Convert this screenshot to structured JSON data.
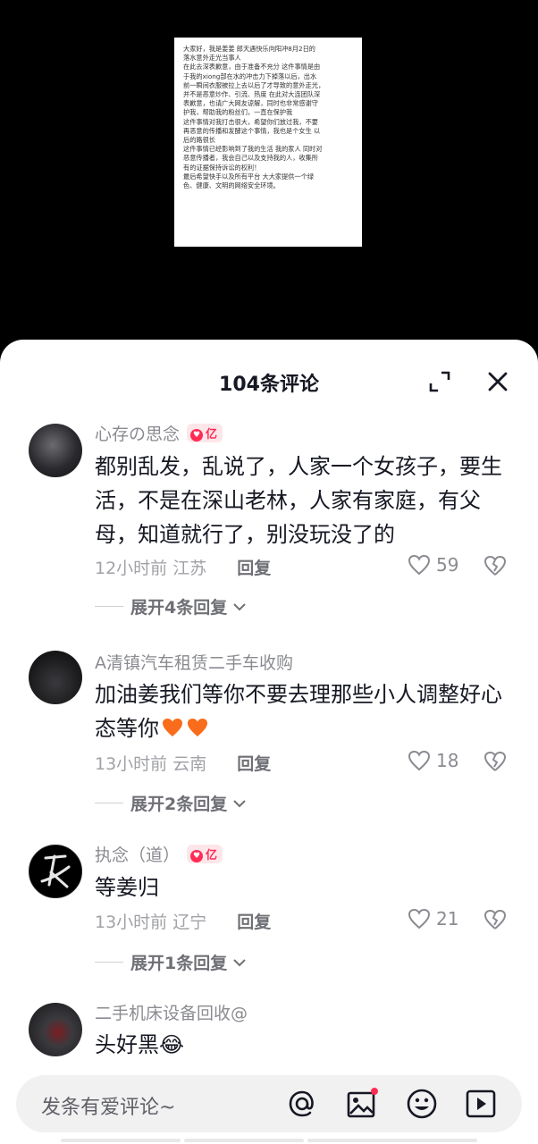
{
  "video": {
    "document_lines": [
      "大家好，我是姜姜 郎天遇快乐向阳冲8月2日的",
      "落水意外走光当事人",
      "在此去深表歉意，由于准备不充分 这件事情是由",
      "于我的xiong部在水的冲击力下掉落以后，出水",
      "前一瞬间衣服被拉上去以后了才导致的意外走光，",
      "并不是恶意炒作、引流、热度 在此对大连团队深",
      "表歉意，也请广大网友谅解，同时也非常感谢守",
      "护我，帮助我的粉丝们，一直在保护我",
      "这件事情对我打击很大，希望你们放过我，不要",
      "再恶意的传播和发酵这个事情，我也是个女生 以",
      "后的路很长",
      "这件事情已经影响到了我的生活 我的家人 同时对",
      "恶意传播者，我会自己以及支持我的人，收集所",
      "有的证据保持诉讼的权利！",
      "最后希望快手以及所有平台 大大家提供一个绿",
      "色、健康、文明的网络安全环境。"
    ]
  },
  "sheet": {
    "title": "104条评论"
  },
  "comments": [
    {
      "username": "心存の思念",
      "badge": "亿",
      "text": "都别乱发，乱说了，人家一个女孩子，要生活，不是在深山老林，人家有家庭，有父母，知道就行了，别没玩没了的",
      "time": "12小时前",
      "location": "江苏",
      "reply_label": "回复",
      "likes": "59",
      "expand_label": "展开4条回复"
    },
    {
      "username": "A清镇汽车租赁二手车收购",
      "badge": "",
      "text": "加油姜我们等你不要去理那些小人调整好心态等你",
      "time": "13小时前",
      "location": "云南",
      "reply_label": "回复",
      "likes": "18",
      "expand_label": "展开2条回复"
    },
    {
      "username": "执念（道）",
      "badge": "亿",
      "text": "等姜归",
      "time": "13小时前",
      "location": "辽宁",
      "reply_label": "回复",
      "likes": "21",
      "expand_label": "展开1条回复"
    },
    {
      "username": "二手机床设备回收@",
      "badge": "",
      "text": "头好黑😂",
      "time": "",
      "location": "",
      "reply_label": "",
      "likes": "",
      "expand_label": ""
    }
  ],
  "input": {
    "placeholder": "发条有爱评论~"
  },
  "icons": {
    "expand": "fullscreen-icon",
    "close": "close-icon",
    "like": "heart-outline-icon",
    "dislike": "broken-heart-icon",
    "mention": "at-icon",
    "image": "image-icon",
    "emoji": "smile-icon",
    "video": "play-box-icon"
  },
  "colors": {
    "accent": "#fe2c55",
    "background": "#ffffff",
    "muted": "#8a8b91"
  }
}
